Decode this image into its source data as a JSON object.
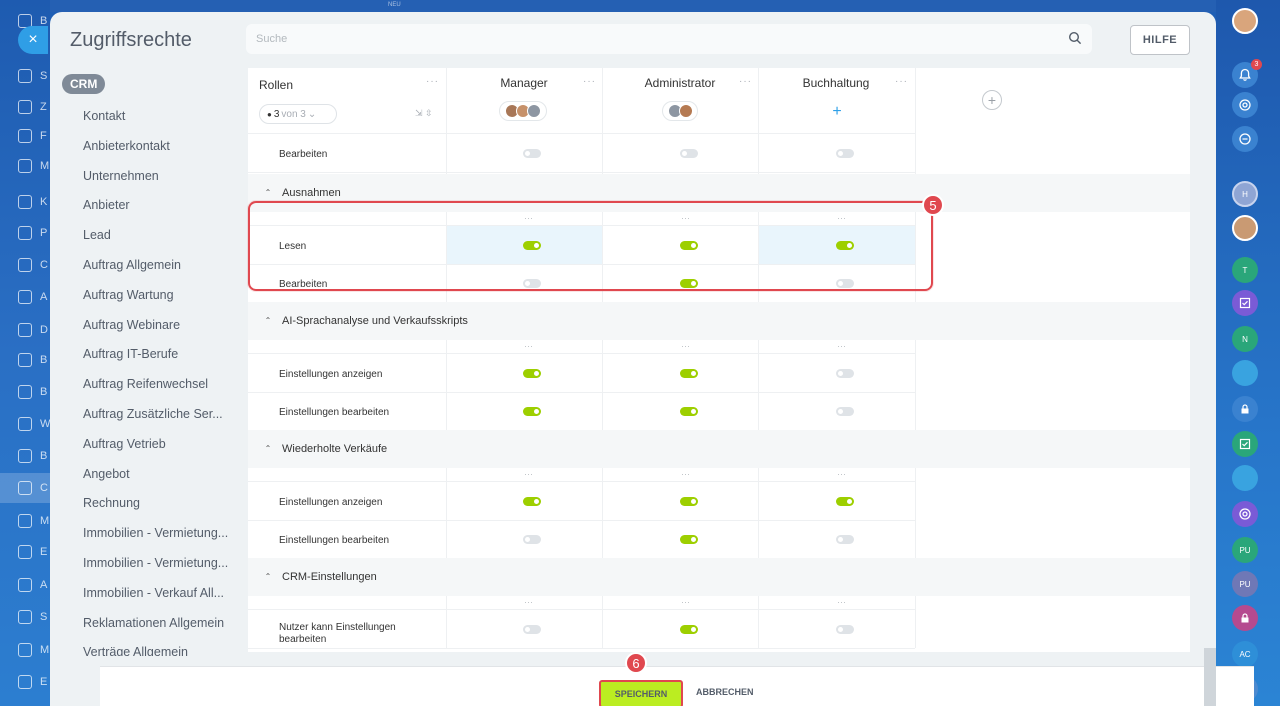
{
  "modal": {
    "title": "Zugriffsrechte",
    "search_placeholder": "Suche",
    "help_label": "HILFE"
  },
  "nav": {
    "tag": "CRM",
    "items": [
      "Kontakt",
      "Anbieterkontakt",
      "Unternehmen",
      "Anbieter",
      "Lead",
      "Auftrag Allgemein",
      "Auftrag Wartung",
      "Auftrag Webinare",
      "Auftrag IT-Berufe",
      "Auftrag Reifenwechsel",
      "Auftrag Zusätzliche Ser...",
      "Auftrag Vetrieb",
      "Angebot",
      "Rechnung",
      "Immobilien - Vermietung...",
      "Immobilien - Vermietung...",
      "Immobilien - Verkauf All...",
      "Reklamationen Allgemein",
      "Verträge Allgemein"
    ]
  },
  "bg_nav_letters": [
    "B",
    "S",
    "Z",
    "F",
    "M",
    "K",
    "P",
    "C",
    "A",
    "D",
    "B",
    "B",
    "W",
    "B",
    "C",
    "M",
    "E",
    "A",
    "S",
    "M",
    "E"
  ],
  "table": {
    "roles_header": "Rollen",
    "filter": {
      "count": "3",
      "of": "von 3"
    },
    "columns": [
      "Manager",
      "Administrator",
      "Buchhaltung"
    ],
    "top_row": {
      "label": "Bearbeiten",
      "values": [
        false,
        false,
        false
      ]
    },
    "sections": [
      {
        "title": "Ausnahmen",
        "rows": [
          {
            "label": "Lesen",
            "values": [
              true,
              true,
              true
            ]
          },
          {
            "label": "Bearbeiten",
            "values": [
              false,
              true,
              false
            ]
          }
        ]
      },
      {
        "title": "AI-Sprachanalyse und Verkaufsskripts",
        "rows": [
          {
            "label": "Einstellungen anzeigen",
            "values": [
              true,
              true,
              false
            ]
          },
          {
            "label": "Einstellungen bearbeiten",
            "values": [
              true,
              true,
              false
            ]
          }
        ]
      },
      {
        "title": "Wiederholte Verkäufe",
        "rows": [
          {
            "label": "Einstellungen anzeigen",
            "values": [
              true,
              true,
              true
            ]
          },
          {
            "label": "Einstellungen bearbeiten",
            "values": [
              false,
              true,
              false
            ]
          }
        ]
      },
      {
        "title": "CRM-Einstellungen",
        "rows": [
          {
            "label": "Nutzer kann Einstellungen bearbeiten",
            "values": [
              false,
              true,
              false
            ]
          }
        ]
      }
    ]
  },
  "annotations": {
    "step5": "5",
    "step6": "6"
  },
  "footer": {
    "save_label": "SPEICHERN",
    "cancel_label": "ABBRECHEN"
  },
  "right_bar": {
    "notification_count": "3",
    "avatars": [
      "H",
      "T",
      "N",
      "PU",
      "PU",
      "AC"
    ]
  },
  "bg_top_label": "NEU"
}
